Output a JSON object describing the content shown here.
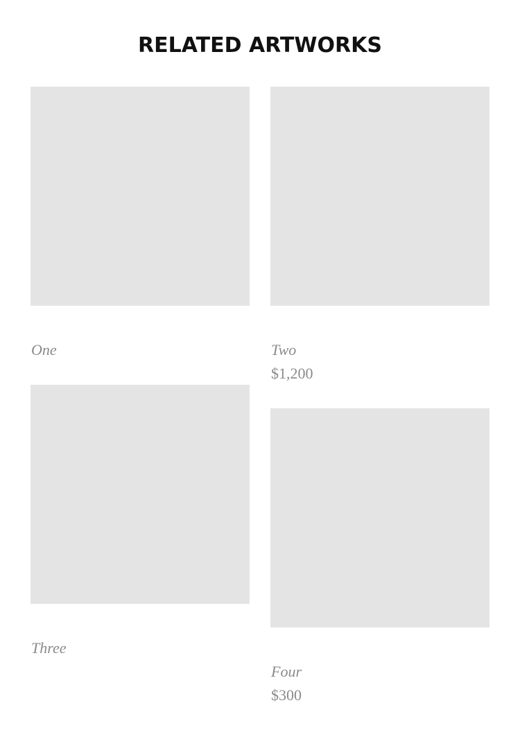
{
  "section": {
    "title": "RELATED ARTWORKS"
  },
  "artworks": [
    {
      "name": "One",
      "price": ""
    },
    {
      "name": "Two",
      "price": "$1,200"
    },
    {
      "name": "Three",
      "price": ""
    },
    {
      "name": "Four",
      "price": "$300"
    }
  ],
  "colors": {
    "placeholder": "#e4e4e4",
    "caption": "#8a8a8a",
    "title": "#111111"
  }
}
